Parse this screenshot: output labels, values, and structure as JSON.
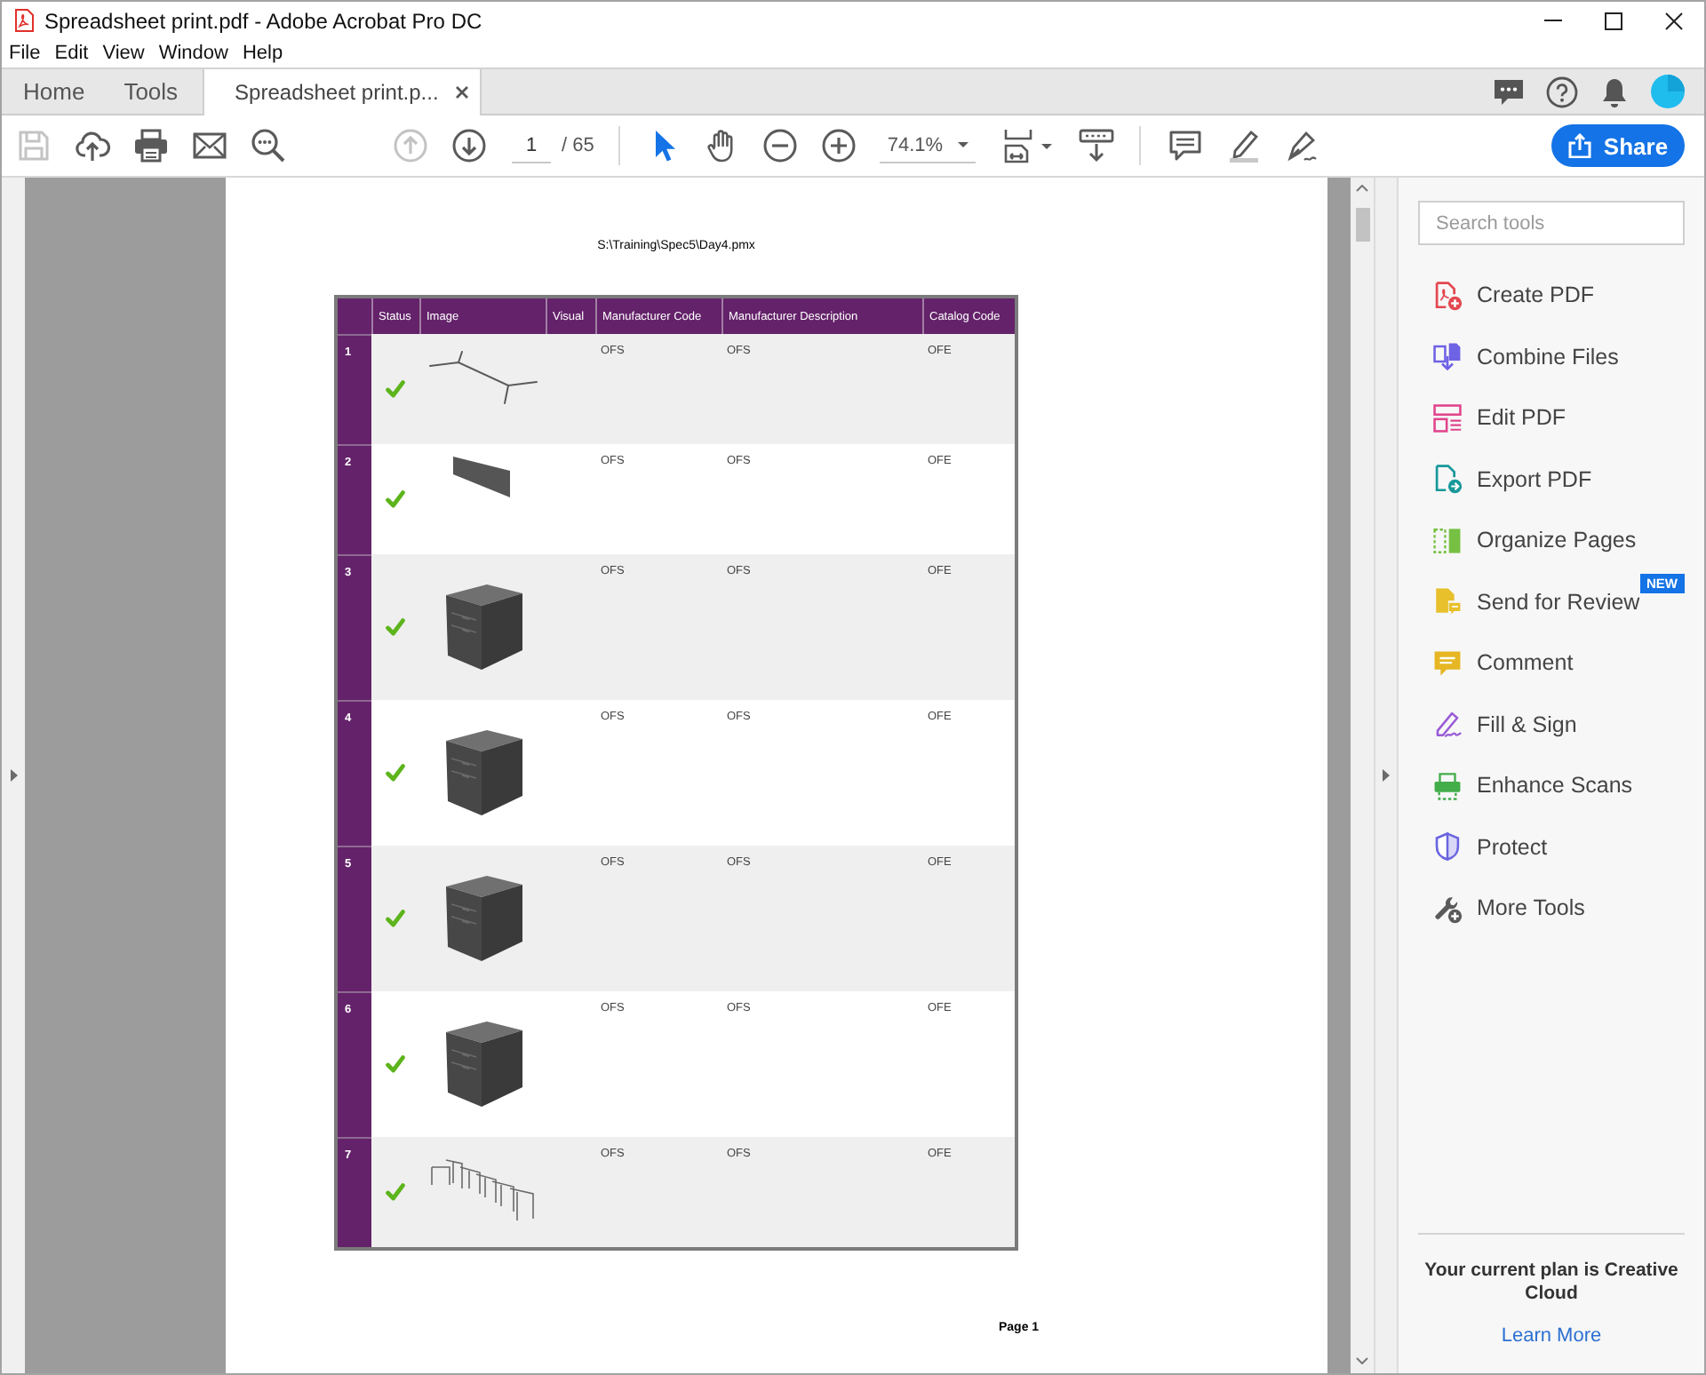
{
  "window": {
    "title": "Spreadsheet print.pdf - Adobe Acrobat Pro DC"
  },
  "menu": [
    "File",
    "Edit",
    "View",
    "Window",
    "Help"
  ],
  "tabs": [
    {
      "label": "Home",
      "selected": false,
      "closable": false
    },
    {
      "label": "Tools",
      "selected": false,
      "closable": false
    },
    {
      "label": "Spreadsheet print.p...",
      "selected": true,
      "closable": true
    }
  ],
  "toolbar": {
    "save_disabled": true,
    "previous_page_disabled": true,
    "page": "1",
    "page_count": "/ 65",
    "zoom": "74.1%",
    "share": "Share"
  },
  "document": {
    "path": "S:\\Training\\Spec5\\Day4.pmx",
    "table": {
      "columns": [
        "Status",
        "Image",
        "Visual",
        "Manufacturer Code",
        "Manufacturer Description",
        "Catalog Code"
      ],
      "rows": [
        {
          "number": "1",
          "status_ok": true,
          "kind": "frame",
          "manufacturer_code": "OFS",
          "manufacturer_description": "OFS",
          "catalog_code": "OFE"
        },
        {
          "number": "2",
          "status_ok": true,
          "kind": "panel",
          "manufacturer_code": "OFS",
          "manufacturer_description": "OFS",
          "catalog_code": "OFE"
        },
        {
          "number": "3",
          "status_ok": true,
          "kind": "pedestal",
          "manufacturer_code": "OFS",
          "manufacturer_description": "OFS",
          "catalog_code": "OFE"
        },
        {
          "number": "4",
          "status_ok": true,
          "kind": "pedestal",
          "manufacturer_code": "OFS",
          "manufacturer_description": "OFS",
          "catalog_code": "OFE"
        },
        {
          "number": "5",
          "status_ok": true,
          "kind": "pedestal",
          "manufacturer_code": "OFS",
          "manufacturer_description": "OFS",
          "catalog_code": "OFE"
        },
        {
          "number": "6",
          "status_ok": true,
          "kind": "pedestal",
          "manufacturer_code": "OFS",
          "manufacturer_description": "OFS",
          "catalog_code": "OFE"
        },
        {
          "number": "7",
          "status_ok": true,
          "kind": "bench",
          "manufacturer_code": "OFS",
          "manufacturer_description": "OFS",
          "catalog_code": "OFE"
        }
      ]
    },
    "footer": "Page 1"
  },
  "tools_pane": {
    "search": {
      "placeholder": "Search tools"
    },
    "tools": [
      {
        "label": "Create PDF"
      },
      {
        "label": "Combine Files"
      },
      {
        "label": "Edit PDF"
      },
      {
        "label": "Export PDF"
      },
      {
        "label": "Organize Pages"
      },
      {
        "label": "Send for Review",
        "badge": "NEW"
      },
      {
        "label": "Comment"
      },
      {
        "label": "Fill & Sign"
      },
      {
        "label": "Enhance Scans"
      },
      {
        "label": "Protect"
      },
      {
        "label": "More Tools"
      }
    ],
    "plan": {
      "message": "Your current plan is Creative Cloud",
      "link": "Learn More"
    }
  }
}
